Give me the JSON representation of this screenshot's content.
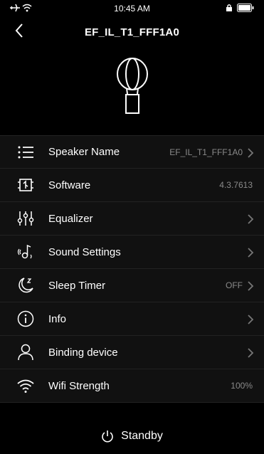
{
  "status_bar": {
    "time": "10:45 AM",
    "icons": [
      "airplane-icon",
      "wifi-icon",
      "lock-icon",
      "battery-icon"
    ]
  },
  "header": {
    "title": "EF_IL_T1_FFF1A0",
    "back_icon": "chevron-left-icon"
  },
  "device_image": "balloon-speaker-icon",
  "settings": {
    "speaker_name": {
      "label": "Speaker Name",
      "value": "EF_IL_T1_FFF1A0",
      "icon": "list-icon"
    },
    "software": {
      "label": "Software",
      "value": "4.3.7613",
      "icon": "chip-icon"
    },
    "equalizer": {
      "label": "Equalizer",
      "icon": "equalizer-icon"
    },
    "sound_settings": {
      "label": "Sound Settings",
      "icon": "sound-note-icon"
    },
    "sleep_timer": {
      "label": "Sleep Timer",
      "value": "OFF",
      "icon": "moon-icon"
    },
    "info": {
      "label": "Info",
      "icon": "info-icon"
    },
    "binding_device": {
      "label": "Binding device",
      "icon": "user-icon"
    },
    "wifi_strength": {
      "label": "Wifi Strength",
      "value": "100%",
      "icon": "wifi-icon"
    }
  },
  "footer": {
    "standby_label": "Standby",
    "standby_icon": "power-icon"
  },
  "colors": {
    "background": "#000000",
    "list_background": "#111111",
    "text": "#ffffff",
    "secondary_text": "#8a8a8a",
    "divider": "#222222"
  }
}
